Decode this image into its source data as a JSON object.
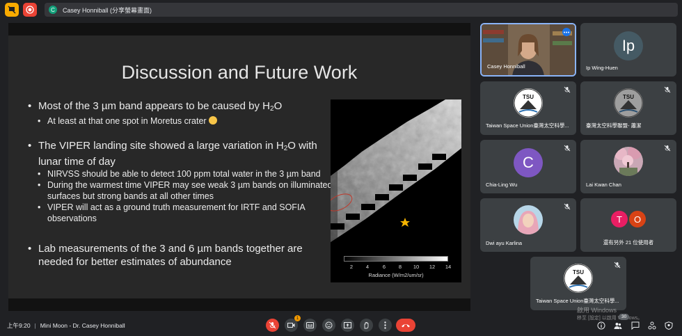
{
  "topbar": {
    "presenter_label": "Casey Honniball (分享螢幕畫面)",
    "presenter_initial": "C"
  },
  "slide": {
    "title": "Discussion and Future Work",
    "b1_text": "Most of the 3 µm band appears to be caused by H",
    "b1_sub": "2",
    "b1_tail": "O",
    "b1a": "At least at that one spot in Moretus crater",
    "b2_text": "The VIPER landing site showed a large variation in H",
    "b2_sub": "2",
    "b2_tail": "O with lunar time of day",
    "b2a": "NIRVSS should be able to detect 100 ppm total water in the 3 µm band",
    "b2b": "During the warmest time VIPER may see weak 3 µm bands on illuminated surfaces but strong bands at all other times",
    "b2c": "VIPER will act as a ground truth measurement for IRTF and SOFIA observations",
    "b3": "Lab measurements of the 3 and 6 µm bands together are needed for better estimates of abundance",
    "colorbar_ticks": [
      "2",
      "4",
      "6",
      "8",
      "10",
      "12",
      "14"
    ],
    "colorbar_label": "Radiance (W/m2/um/sr)"
  },
  "participants": [
    {
      "name": "Casey Honniball",
      "type": "video"
    },
    {
      "name": "Ip Wing-Huen",
      "type": "letter",
      "initial": "Ip",
      "color": "#455a64"
    },
    {
      "name": "Taiwan Space Union臺灣太空科學...",
      "type": "logo",
      "logo_text": "TSU"
    },
    {
      "name": "臺灣太空科學聯盟- 蕭潔",
      "type": "logo",
      "logo_text": "TSU"
    },
    {
      "name": "Chia-Ling Wu",
      "type": "letter",
      "initial": "C",
      "color": "#7e57c2"
    },
    {
      "name": "Lai Kwan Chan",
      "type": "photo"
    },
    {
      "name": "Dwi ayu Karlina",
      "type": "photo"
    },
    {
      "name": "還有另外 21 位使用者",
      "type": "more",
      "initials": [
        "T",
        "O"
      ]
    },
    {
      "name": "Taiwan Space Union臺灣太空科學...",
      "type": "logo",
      "logo_text": "TSU"
    }
  ],
  "bottombar": {
    "time": "上午9:20",
    "meeting_title": "Mini Moon - Dr. Casey Honniball",
    "participant_count": "30",
    "notification_count": "1"
  },
  "watermark": {
    "line1": "啟用 Windows",
    "line2": "移至 [設定] 以啟用 Windows。"
  },
  "colors": {
    "end_call": "#ea4335",
    "presenting_border": "#8ab4f8",
    "alert_badge": "#f29900"
  }
}
